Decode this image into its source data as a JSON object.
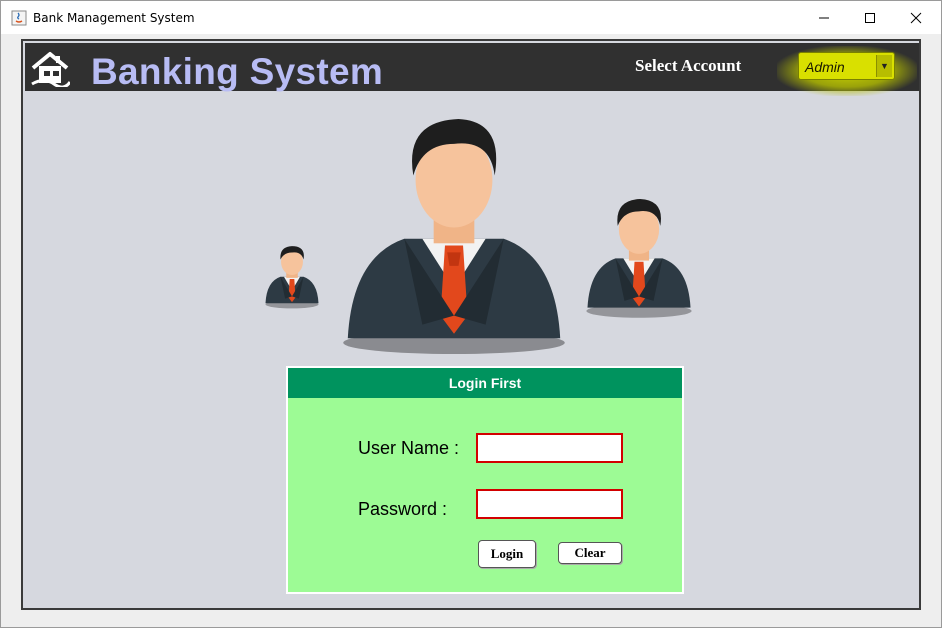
{
  "window": {
    "title": "Bank Management System",
    "controls": {
      "minimize": "minimize-icon",
      "maximize": "maximize-icon",
      "close": "close-icon"
    }
  },
  "header": {
    "title": "Banking System",
    "home_icon": "home-icon",
    "select_label": "Select Account",
    "account_selected": "Admin",
    "colors": {
      "bar": "#303030",
      "title": "#b8bcf4",
      "combo": "#d9e000"
    }
  },
  "avatars": [
    "user-icon",
    "user-icon",
    "user-icon"
  ],
  "login": {
    "heading": "Login First",
    "username_label": "User Name :",
    "password_label": "Password :",
    "username_value": "",
    "password_value": "",
    "login_button": "Login",
    "clear_button": "Clear",
    "colors": {
      "panel": "#9dfb95",
      "heading": "#00935e",
      "field_border": "#d20000"
    }
  }
}
